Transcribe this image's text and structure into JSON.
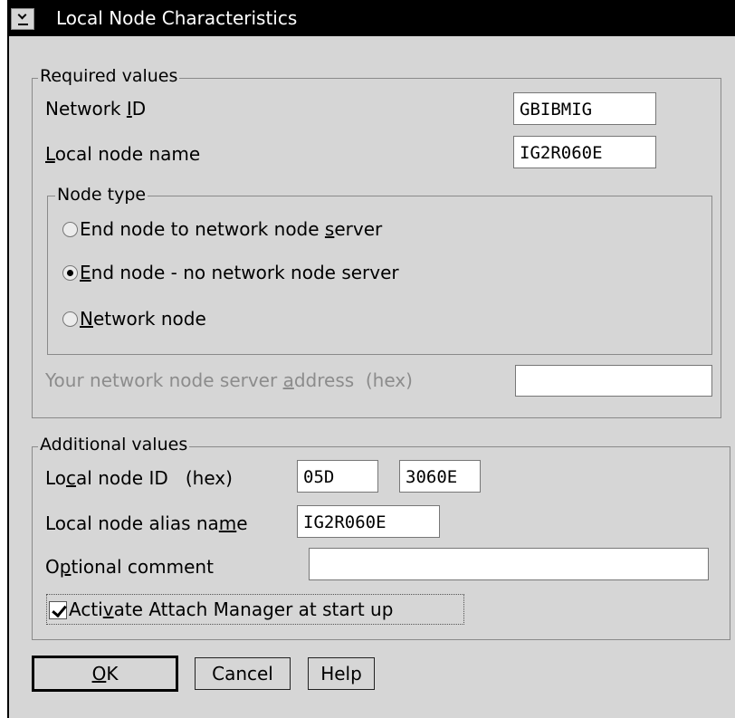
{
  "window": {
    "title": "Local Node Characteristics",
    "system_menu_icon": "system-menu-icon"
  },
  "required": {
    "group_label": "Required values",
    "network_id_label": "Network ID",
    "network_id_value": "GBIBMIG",
    "local_node_name_label": "Local node name",
    "local_node_name_value": "IG2R060E",
    "node_type": {
      "group_label": "Node type",
      "options": [
        {
          "label": "End node to network node server",
          "selected": false
        },
        {
          "label": "End node - no network node server",
          "selected": true
        },
        {
          "label": "Network node",
          "selected": false
        }
      ]
    },
    "server_address_label": "Your network node server address  (hex)",
    "server_address_value": ""
  },
  "additional": {
    "group_label": "Additional values",
    "local_node_id_label": "Local node ID  (hex)",
    "local_node_id_part1": "05D",
    "local_node_id_part2": "3060E",
    "alias_label": "Local node alias name",
    "alias_value": "IG2R060E",
    "comment_label": "Optional comment",
    "comment_value": "",
    "attach_manager_label": "Activate Attach Manager at start up",
    "attach_manager_checked": true
  },
  "buttons": {
    "ok": "OK",
    "cancel": "Cancel",
    "help": "Help"
  }
}
